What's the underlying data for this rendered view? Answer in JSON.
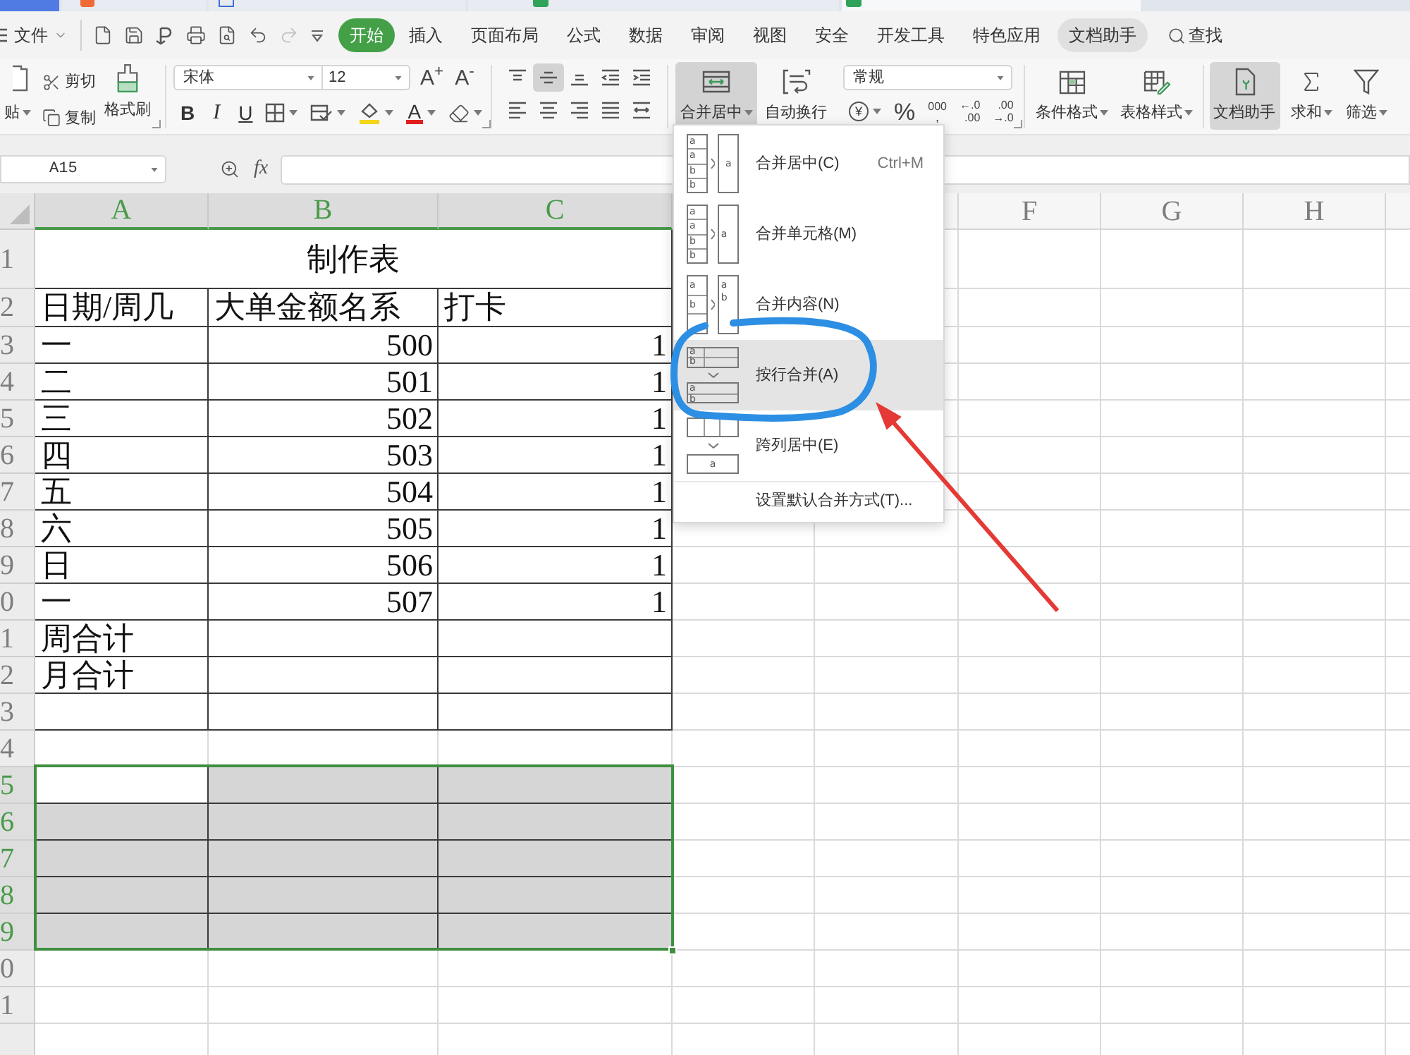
{
  "document_tabs": [
    {
      "kind": "home",
      "selected": false
    },
    {
      "kind": "template",
      "selected": false
    },
    {
      "kind": "writer",
      "selected": false
    },
    {
      "kind": "sheet",
      "selected": false
    },
    {
      "kind": "sheet",
      "selected": true
    }
  ],
  "menu_bar": {
    "file": "文件",
    "tabs": [
      {
        "label": "开始",
        "selected": true,
        "highlighted": false
      },
      {
        "label": "插入",
        "selected": false,
        "highlighted": false
      },
      {
        "label": "页面布局",
        "selected": false,
        "highlighted": false
      },
      {
        "label": "公式",
        "selected": false,
        "highlighted": false
      },
      {
        "label": "数据",
        "selected": false,
        "highlighted": false
      },
      {
        "label": "审阅",
        "selected": false,
        "highlighted": false
      },
      {
        "label": "视图",
        "selected": false,
        "highlighted": false
      },
      {
        "label": "安全",
        "selected": false,
        "highlighted": false
      },
      {
        "label": "开发工具",
        "selected": false,
        "highlighted": false
      },
      {
        "label": "特色应用",
        "selected": false,
        "highlighted": false
      },
      {
        "label": "文档助手",
        "selected": false,
        "highlighted": true
      }
    ],
    "search": "查找"
  },
  "ribbon": {
    "clipboard": {
      "paste": "贴",
      "cut": "剪切",
      "copy": "复制",
      "format_painter": "格式刷"
    },
    "font": {
      "name": "宋体",
      "size": "12",
      "grow": "A$^{+}$",
      "shrink": "A$^{-}$",
      "bold": "B",
      "italic": "I",
      "underline": "U",
      "tint": "A"
    },
    "alignment": [
      {
        "kind": "top",
        "selected": false
      },
      {
        "kind": "middle",
        "selected": true
      },
      {
        "kind": "bottom",
        "selected": false
      },
      {
        "kind": "outdent",
        "selected": false
      },
      {
        "kind": "indent",
        "selected": false
      },
      {
        "kind": "left",
        "selected": false
      },
      {
        "kind": "center",
        "selected": false
      },
      {
        "kind": "right",
        "selected": false
      },
      {
        "kind": "justify",
        "selected": false
      },
      {
        "kind": "distributed",
        "selected": false
      }
    ],
    "merge": {
      "label": "合并居中",
      "open": true
    },
    "wrap": "自动换行",
    "number": {
      "format": "常规",
      "currency": "¥",
      "percent": "%",
      "thousands": [
        "000",
        ","
      ],
      "decimal_increase": [
        "←.0",
        ".00"
      ],
      "decimal_decrease": [
        ".00",
        "→.0"
      ]
    },
    "styles": [
      {
        "kind": "conditional",
        "label": "条件格式"
      },
      {
        "kind": "table",
        "label": "表格样式"
      }
    ],
    "tools": [
      {
        "kind": "assistant",
        "label": "文档助手",
        "selected": true,
        "dropdown": false
      },
      {
        "kind": "sum",
        "label": "求和",
        "selected": false,
        "dropdown": true
      },
      {
        "kind": "filter",
        "label": "筛选",
        "selected": false,
        "dropdown": true
      }
    ]
  },
  "formula_bar": {
    "name_box": "A15",
    "function_label": "fx"
  },
  "sheet": {
    "columns": [
      {
        "label": "A",
        "selected": true
      },
      {
        "label": "B",
        "selected": true
      },
      {
        "label": "C",
        "selected": true
      },
      {
        "label": "F",
        "selected": false
      },
      {
        "label": "G",
        "selected": false
      },
      {
        "label": "H",
        "selected": false
      }
    ],
    "rows": [
      {
        "number": "1",
        "kind": "title",
        "selected": false,
        "cells": [
          "制作表"
        ]
      },
      {
        "number": "2",
        "kind": "header",
        "selected": false,
        "cells": [
          "日期/周几",
          "大单金额名系",
          "打卡"
        ]
      },
      {
        "number": "3",
        "kind": "data",
        "selected": false,
        "cells": [
          "一",
          "500",
          "1"
        ]
      },
      {
        "number": "4",
        "kind": "data",
        "selected": false,
        "cells": [
          "二",
          "501",
          "1"
        ]
      },
      {
        "number": "5",
        "kind": "data",
        "selected": false,
        "cells": [
          "三",
          "502",
          "1"
        ]
      },
      {
        "number": "6",
        "kind": "data",
        "selected": false,
        "cells": [
          "四",
          "503",
          "1"
        ]
      },
      {
        "number": "7",
        "kind": "data",
        "selected": false,
        "cells": [
          "五",
          "504",
          "1"
        ]
      },
      {
        "number": "8",
        "kind": "data",
        "selected": false,
        "cells": [
          "六",
          "505",
          "1"
        ]
      },
      {
        "number": "9",
        "kind": "data",
        "selected": false,
        "cells": [
          "日",
          "506",
          "1"
        ]
      },
      {
        "number": "0",
        "kind": "data",
        "selected": false,
        "cells": [
          "一",
          "507",
          "1"
        ]
      },
      {
        "number": "1",
        "kind": "data",
        "selected": false,
        "cells": [
          "周合计"
        ]
      },
      {
        "number": "2",
        "kind": "data",
        "selected": false,
        "cells": [
          "月合计"
        ]
      },
      {
        "number": "3",
        "kind": "data",
        "selected": false
      },
      {
        "number": "4",
        "kind": "blank",
        "selected": false
      },
      {
        "number": "5",
        "kind": "blank",
        "selected": true,
        "cells": [
          {
            "selected": false
          },
          {
            "selected": true
          },
          {
            "selected": true
          }
        ]
      },
      {
        "number": "6",
        "kind": "blank",
        "selected": true,
        "cells": [
          {
            "selected": true
          },
          {
            "selected": true
          },
          {
            "selected": true
          }
        ]
      },
      {
        "number": "7",
        "kind": "blank",
        "selected": true,
        "cells": [
          {
            "selected": true
          },
          {
            "selected": true
          },
          {
            "selected": true
          }
        ]
      },
      {
        "number": "8",
        "kind": "blank",
        "selected": true,
        "cells": [
          {
            "selected": true
          },
          {
            "selected": true
          },
          {
            "selected": true
          }
        ]
      },
      {
        "number": "9",
        "kind": "blank",
        "selected": true,
        "cells": [
          {
            "selected": true
          },
          {
            "selected": true
          },
          {
            "selected": true
          }
        ]
      },
      {
        "number": "0",
        "kind": "blank",
        "selected": false
      },
      {
        "number": "1",
        "kind": "blank",
        "selected": false
      },
      {
        "kind": "blank",
        "selected": false
      }
    ]
  },
  "merge_menu": {
    "items": [
      {
        "kind": "center",
        "label": "合并居中(C)",
        "shortcut": "Ctrl+M",
        "highlighted": false,
        "icon_text": {
          "from": [
            "a",
            "a",
            "b",
            "b"
          ],
          "to": [
            "a"
          ]
        }
      },
      {
        "kind": "cells",
        "label": "合并单元格(M)",
        "highlighted": false,
        "icon_text": {
          "from": [
            "a",
            "a",
            "b",
            "b"
          ],
          "to": [
            "a"
          ]
        }
      },
      {
        "kind": "content",
        "label": "合并内容(N)",
        "highlighted": false,
        "icon_text": {
          "from": [
            "a",
            "b"
          ],
          "to": [
            "a",
            "b"
          ]
        }
      },
      {
        "kind": "rows",
        "label": "按行合并(A)",
        "highlighted": true,
        "icon_text": {
          "from": [
            "a",
            "b"
          ],
          "to": [
            "a",
            "b"
          ]
        }
      },
      {
        "kind": "across",
        "label": "跨列居中(E)",
        "highlighted": false,
        "icon_text": {
          "to": [
            "a"
          ]
        }
      },
      {
        "kind": "setting",
        "label": "设置默认合并方式(T)...",
        "highlighted": false
      }
    ]
  }
}
